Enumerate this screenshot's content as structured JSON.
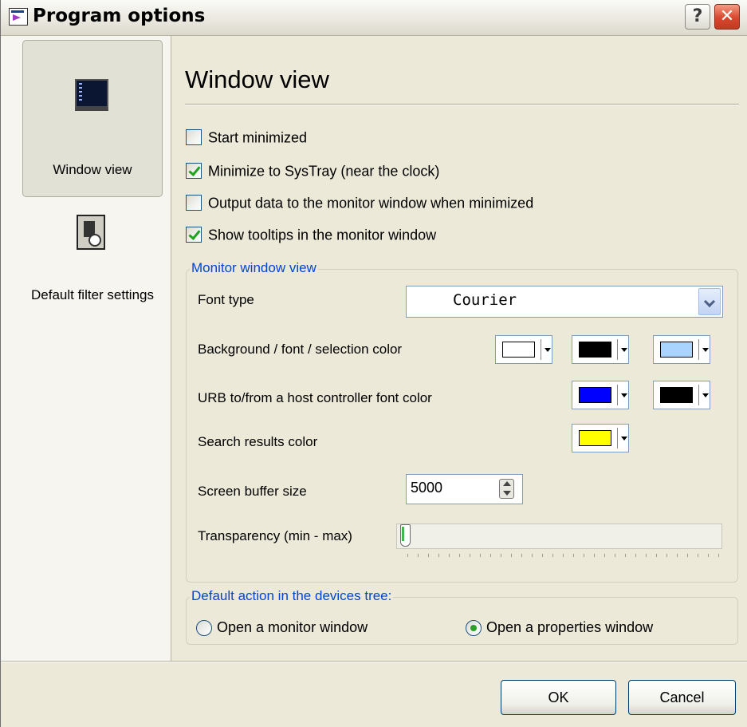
{
  "window": {
    "title": "Program options",
    "help_label": "?",
    "close_label": "✕"
  },
  "nav": {
    "items": [
      {
        "label": "Window view",
        "icon": "window-view-icon",
        "selected": true
      },
      {
        "label": "Default filter settings",
        "icon": "filter-settings-icon",
        "selected": false
      }
    ]
  },
  "page": {
    "title": "Window view",
    "checkboxes": [
      {
        "label": "Start minimized",
        "checked": false
      },
      {
        "label": "Minimize to SysTray (near the clock)",
        "checked": true
      },
      {
        "label": "Output data to the monitor window when minimized",
        "checked": false
      },
      {
        "label": "Show tooltips in the monitor window",
        "checked": true
      }
    ]
  },
  "monitor_group": {
    "legend": "Monitor window view",
    "font_type_label": "Font type",
    "font_type_value": "Courier",
    "colors_label": "Background / font / selection color",
    "colors": {
      "background": "#ffffff",
      "font": "#000000",
      "selection": "#a8d4ff"
    },
    "urb_label": "URB to/from a host controller font color",
    "urb_colors": {
      "to": "#0000ff",
      "from": "#000000"
    },
    "search_label": "Search results color",
    "search_color": "#ffff00",
    "buffer_label": "Screen buffer size",
    "buffer_value": "5000",
    "transparency_label": "Transparency (min - max)",
    "transparency_level": 0
  },
  "default_action_group": {
    "legend": "Default action in the devices tree:",
    "options": [
      {
        "label": "Open a monitor window",
        "selected": false
      },
      {
        "label": "Open a properties window",
        "selected": true
      }
    ]
  },
  "buttons": {
    "ok_label": "OK",
    "cancel_label": "Cancel"
  },
  "theme": {
    "accent": "#0046d5",
    "dialog_bg": "#ece9d8",
    "check_color": "#21a121"
  }
}
